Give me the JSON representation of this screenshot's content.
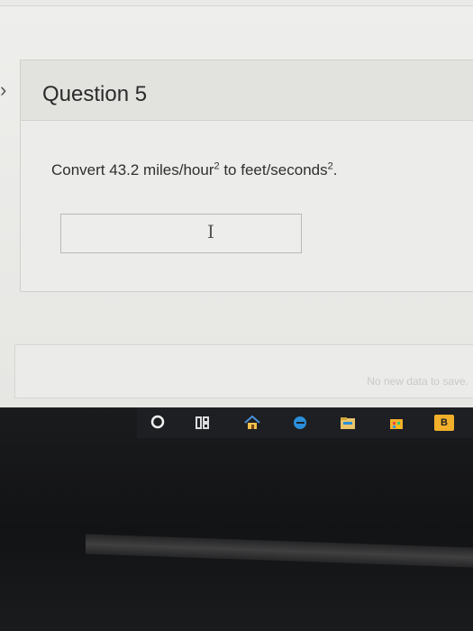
{
  "question": {
    "title": "Question 5",
    "text_parts": [
      "Convert 43.2 miles/hour",
      "2",
      " to feet/seconds",
      "2",
      "."
    ],
    "answer_value": ""
  },
  "save_status": "No new data to save.",
  "taskbar": {
    "icons": [
      "cortana-icon",
      "task-view-icon",
      "home-icon",
      "edge-icon",
      "file-explorer-icon",
      "store-icon",
      "app-b-icon"
    ],
    "app_b_label": "B"
  },
  "colors": {
    "accent_edge": "#2a8fd8",
    "store": "#f2b02a",
    "taskbar": "#1d1f23"
  }
}
